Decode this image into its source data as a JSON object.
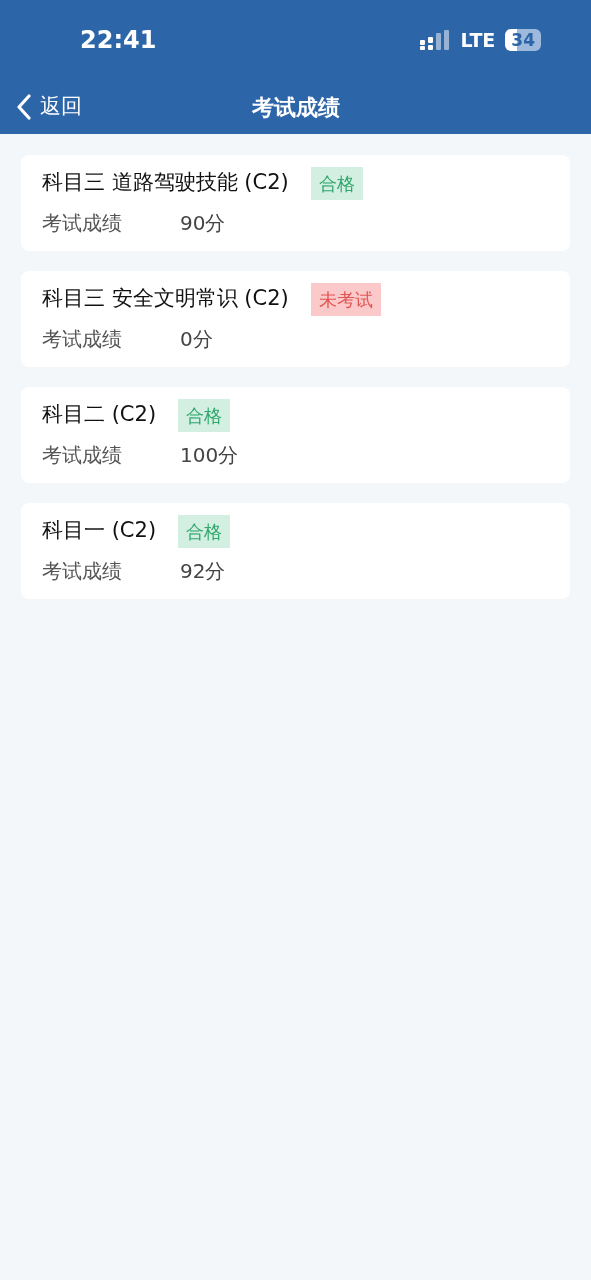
{
  "status_bar": {
    "time": "22:41",
    "network": "LTE",
    "battery": "34"
  },
  "nav": {
    "back": "返回",
    "title": "考试成绩"
  },
  "results": [
    {
      "subject": "科目三 道路驾驶技能 (C2)",
      "badge": "合格",
      "kind": "pass",
      "label": "考试成绩",
      "score": "90分"
    },
    {
      "subject": "科目三 安全文明常识 (C2)",
      "badge": "未考试",
      "kind": "untaken",
      "label": "考试成绩",
      "score": "0分"
    },
    {
      "subject": "科目二 (C2)",
      "badge": "合格",
      "kind": "pass",
      "label": "考试成绩",
      "score": "100分"
    },
    {
      "subject": "科目一 (C2)",
      "badge": "合格",
      "kind": "pass",
      "label": "考试成绩",
      "score": "92分"
    }
  ]
}
